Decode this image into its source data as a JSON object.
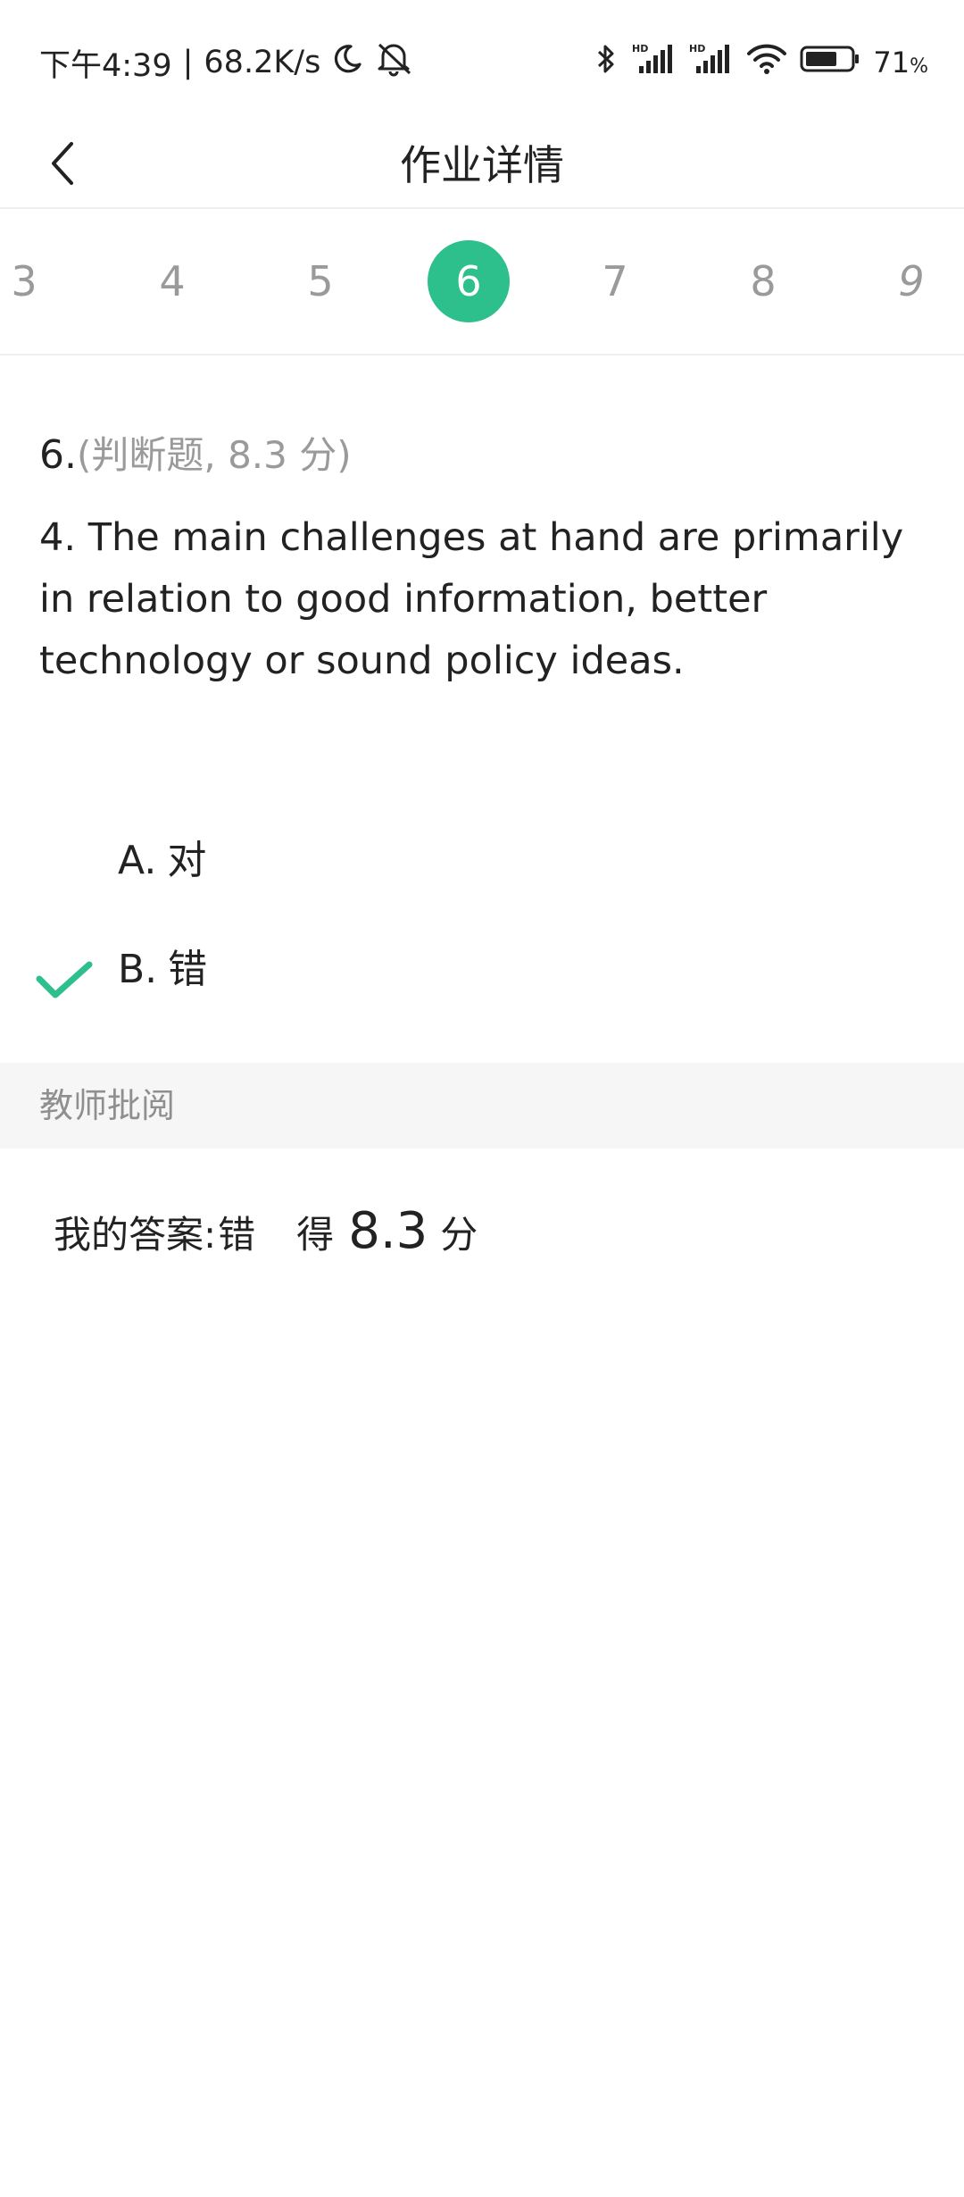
{
  "status_bar": {
    "time": "下午4:39",
    "separator": "|",
    "net_speed": "68.2K/s",
    "battery_percent": "71",
    "battery_unit": "%",
    "battery_level": 0.71,
    "icons": [
      "moon-icon",
      "bell-off-icon",
      "bluetooth-icon",
      "signal-hd-icon",
      "signal-hd-icon",
      "wifi-icon",
      "battery-icon"
    ]
  },
  "header": {
    "title": "作业详情",
    "back_icon": "chevron-left-icon"
  },
  "question_nav": {
    "items": [
      "3",
      "4",
      "5",
      "6",
      "7",
      "8",
      "9"
    ],
    "active": "6"
  },
  "question": {
    "number": "6.",
    "meta": "(判断题,  8.3 分)",
    "text": "4. The main challenges at hand are primarily in relation to good information, better technology or sound policy ideas.",
    "options": [
      {
        "key": "A.",
        "text": "对",
        "selected": false
      },
      {
        "key": "B.",
        "text": "错",
        "selected": true
      }
    ]
  },
  "review": {
    "title": "教师批阅",
    "my_answer_label": "我的答案:",
    "my_answer_value": "错",
    "score_prefix": "得",
    "score_value": "8.3",
    "score_unit": "分"
  },
  "colors": {
    "accent": "#2dbf8c",
    "muted_text": "#9a9a9a",
    "section_bg": "#f6f6f6"
  }
}
